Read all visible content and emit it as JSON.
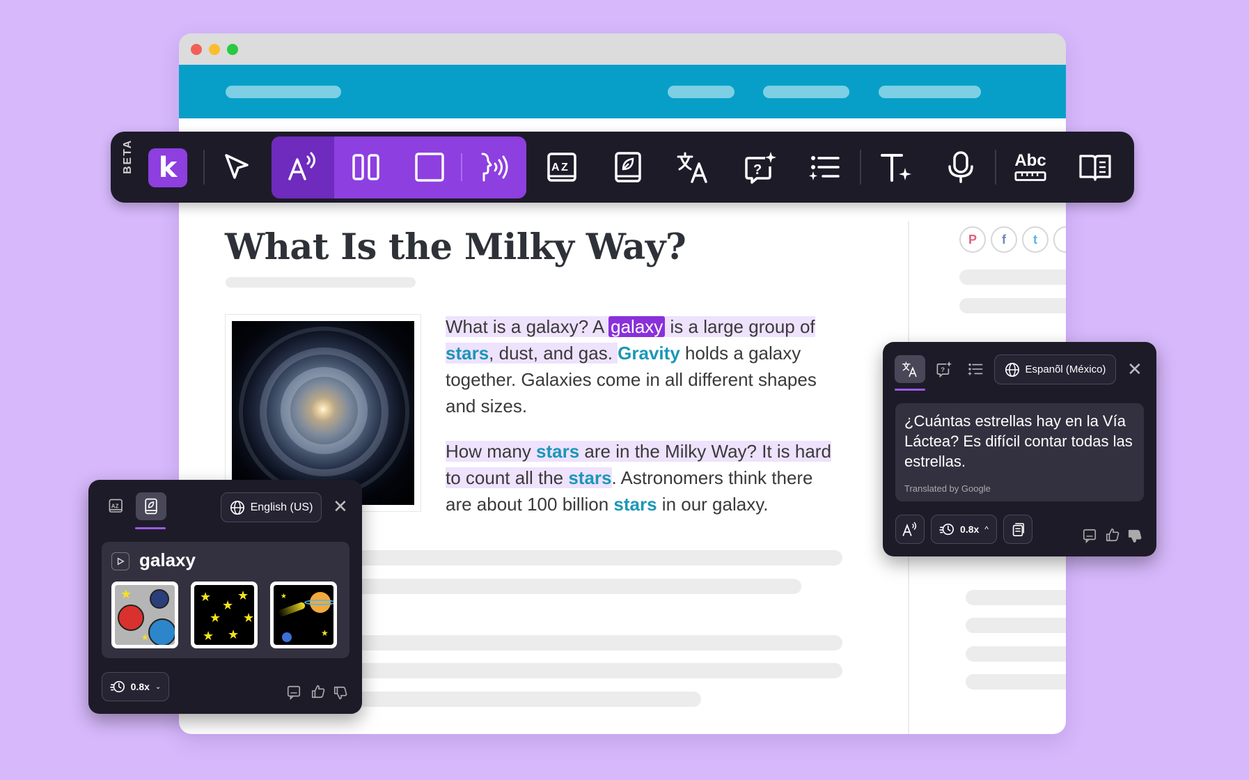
{
  "toolbar": {
    "beta_label": "BETA",
    "logo_letter": "k",
    "buttons": [
      {
        "icon": "cursor-icon"
      },
      {
        "icon": "read-aloud-icon"
      },
      {
        "icon": "columns-icon"
      },
      {
        "icon": "screen-mask-icon"
      },
      {
        "icon": "voice-icon"
      },
      {
        "icon": "picture-dictionary-icon"
      },
      {
        "icon": "dictionary-icon"
      },
      {
        "icon": "translate-icon"
      },
      {
        "icon": "question-sparkle-icon"
      },
      {
        "icon": "list-sparkle-icon"
      },
      {
        "icon": "text-sparkle-icon"
      },
      {
        "icon": "microphone-icon"
      },
      {
        "icon": "spelling-icon",
        "label": "Abc"
      },
      {
        "icon": "reader-view-icon"
      }
    ]
  },
  "article": {
    "title": "What Is the Milky Way?",
    "p1": {
      "t1": "What is a galaxy? A ",
      "selected": "galaxy",
      "t2": " is a large group of ",
      "k1": "stars",
      "t3": ", dust, and gas. ",
      "k2": "Gravity",
      "t4": " holds a galaxy together. Galaxies come in all different shapes and sizes."
    },
    "p2": {
      "t1": "How many ",
      "k1": "stars",
      "t2": " are in the Milky Way? It is hard to count all the ",
      "k2": "stars",
      "t3": ". Astronomers think there are about 100 billion ",
      "k3": "stars",
      "t4": " in our galaxy."
    }
  },
  "social": [
    {
      "icon": "pinterest-icon",
      "glyph": "P",
      "color": "#e0607a"
    },
    {
      "icon": "facebook-icon",
      "glyph": "f",
      "color": "#6f86c0"
    },
    {
      "icon": "twitter-icon",
      "glyph": "t",
      "color": "#5ab3e6"
    },
    {
      "icon": "email-icon",
      "glyph": "✉",
      "color": "#888888"
    }
  ],
  "dictionary_panel": {
    "language": "English (US)",
    "word": "galaxy",
    "speed": "0.8x",
    "thumbnails": [
      "planets-illustration",
      "stars-illustration",
      "comet-planet-illustration"
    ]
  },
  "translate_panel": {
    "language": "Espanõl (México)",
    "translation": "¿Cuántas estrellas hay en la Vía Láctea? Es difícil contar todas las estrellas.",
    "credit": "Translated by Google",
    "speed": "0.8x"
  },
  "colors": {
    "accent": "#8d3fe0",
    "keyword": "#1b97b7",
    "highlight": "#eee2fd",
    "background": "#d6b8fb",
    "site_header": "#079fc8"
  }
}
